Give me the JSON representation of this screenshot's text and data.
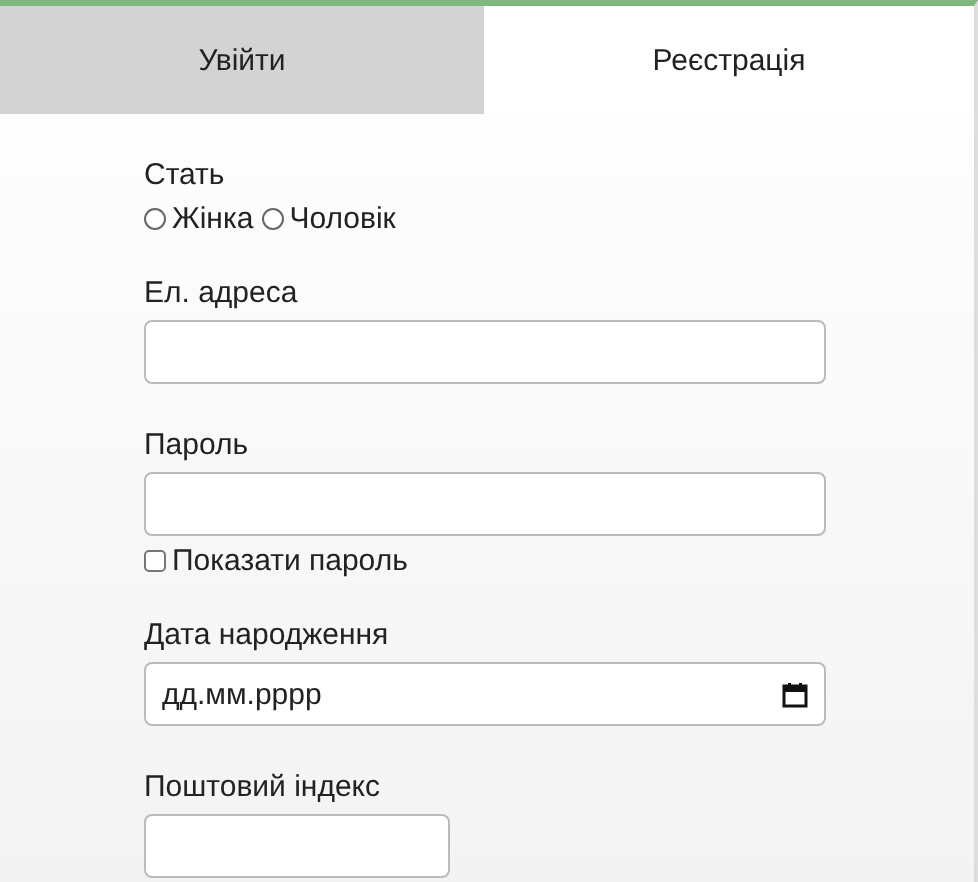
{
  "tabs": [
    {
      "label": "Увійти",
      "selected": false
    },
    {
      "label": "Реєстрація",
      "selected": true
    }
  ],
  "form": {
    "gender": {
      "label": "Стать",
      "options": [
        {
          "label": "Жінка",
          "selected": false
        },
        {
          "label": "Чоловік",
          "selected": false
        }
      ]
    },
    "email": {
      "label": "Ел. адреса"
    },
    "password": {
      "label": "Пароль",
      "show_password": {
        "label": "Показати пароль",
        "checked": false
      }
    },
    "birth_date": {
      "label": "Дата народження",
      "placeholder": "дд.мм.рррр"
    },
    "postal_code": {
      "label": "Поштовий індекс"
    }
  }
}
